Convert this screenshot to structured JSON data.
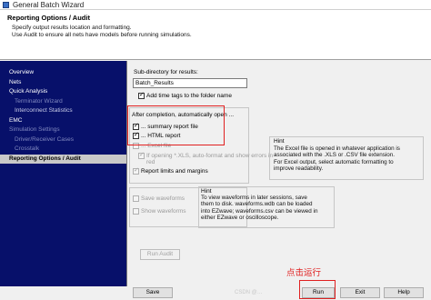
{
  "window": {
    "title": "General Batch Wizard"
  },
  "header": {
    "title": "Reporting Options / Audit",
    "subtitle_line1": "Specify output results location and formatting.",
    "subtitle_line2": "Use Audit to ensure all nets have models before running simulations."
  },
  "sidebar": {
    "items": [
      {
        "label": "Overview",
        "state": "normal"
      },
      {
        "label": "Nets",
        "state": "normal"
      },
      {
        "label": "Quick Analysis",
        "state": "normal"
      },
      {
        "label": "Terminator Wizard",
        "state": "dim"
      },
      {
        "label": "Interconnect Statistics",
        "state": "sub"
      },
      {
        "label": "EMC",
        "state": "normal"
      },
      {
        "label": "Simulation Settings",
        "state": "dim"
      },
      {
        "label": "Driver/Receiver Cases",
        "state": "dim"
      },
      {
        "label": "Crosstalk",
        "state": "dim"
      },
      {
        "label": "Reporting Options / Audit",
        "state": "active"
      }
    ]
  },
  "main": {
    "subdir_label": "Sub-directory for results:",
    "subdir_value": "Batch_Results",
    "add_timetags_label": "Add time tags to the folder name",
    "after_completion_label": "After completion, automatically open ...",
    "summary_report_label": "... summary report file",
    "html_report_label": "... HTML report",
    "excel_file_label": "... Excel file",
    "if_opening_label_line1": "If opening *.XLS, auto-format and show errors in",
    "if_opening_label_line2": "red",
    "report_limits_label": "Report limits and margins",
    "hint1_title": "Hint",
    "hint1_lines": [
      "The Excel file is opened in whatever application is",
      "associated with the .XLS or .CSV file extension.",
      "For Excel output, select automatic formatting to",
      "improve readability."
    ],
    "save_waveforms_label": "Save waveforms",
    "show_waveforms_label": "Show waveforms",
    "hint2_title": "Hint",
    "hint2_lines": [
      "To view waveforms in later sessions, save",
      "them to disk. waveforms.wdb can be loaded",
      "into EZwave; waveforms.csv can be viewed in",
      "either EZwave or oscilloscope."
    ],
    "run_audit_label": "Run Audit"
  },
  "footer": {
    "save_label": "Save",
    "run_label": "Run",
    "exit_label": "Exit",
    "help_label": "Help"
  },
  "annotation": {
    "text": "点击运行",
    "color": "#e02020"
  },
  "watermark": "CSDN @…"
}
